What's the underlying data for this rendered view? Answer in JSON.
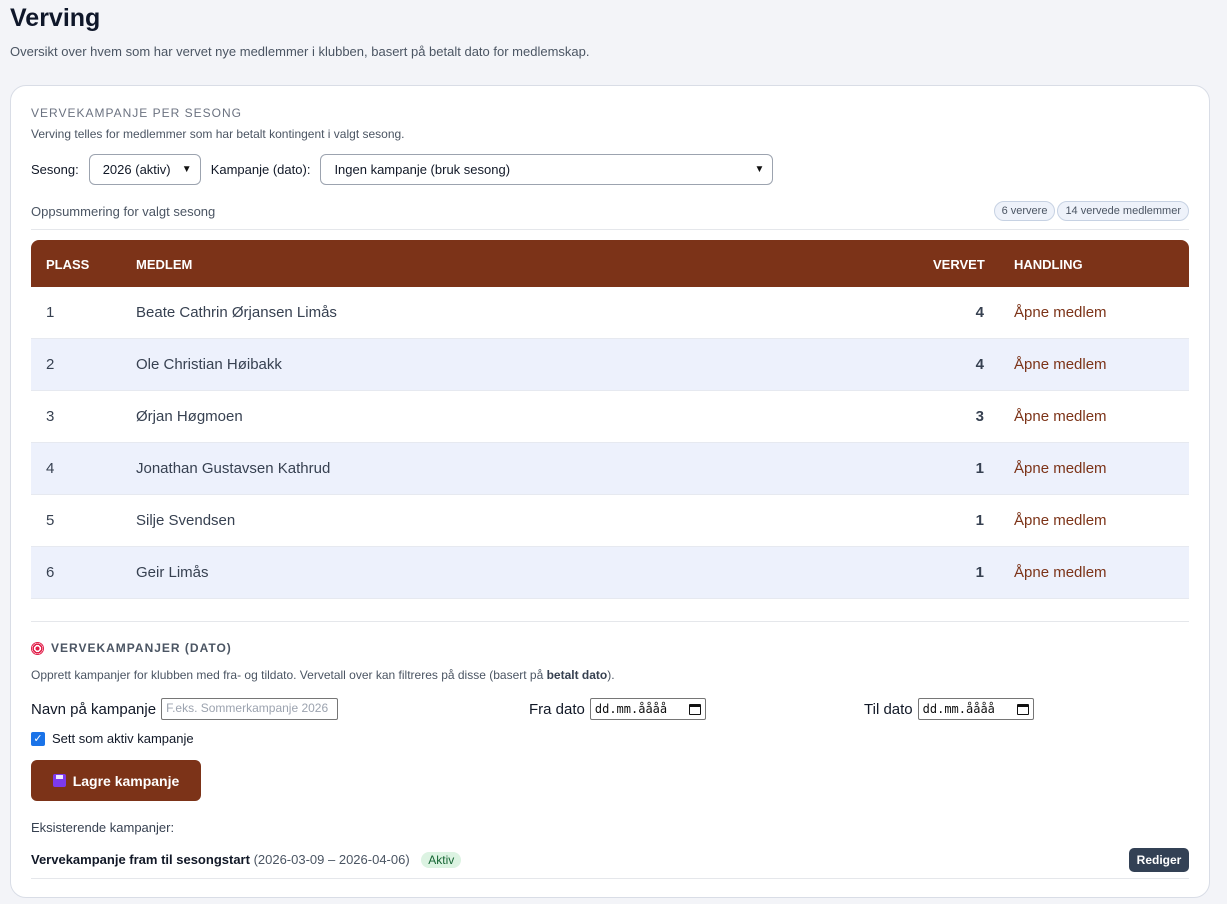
{
  "page": {
    "title": "Verving",
    "subtitle": "Oversikt over hvem som har vervet nye medlemmer i klubben, basert på betalt dato for medlemskap."
  },
  "season_section": {
    "heading": "VERVEKAMPANJE PER SESONG",
    "description": "Verving telles for medlemmer som har betalt kontingent i valgt sesong.",
    "season_label": "Sesong:",
    "season_value": "2026 (aktiv)",
    "campaign_label": "Kampanje (dato):",
    "campaign_value": "Ingen kampanje (bruk sesong)",
    "summary_label": "Oppsummering for valgt sesong",
    "pill_recruiters": "6 ververe",
    "pill_recruited": "14 vervede medlemmer"
  },
  "table": {
    "headers": {
      "place": "PLASS",
      "member": "MEDLEM",
      "recruited": "VERVET",
      "action": "HANDLING"
    },
    "rows": [
      {
        "place": "1",
        "member": "Beate Cathrin Ørjansen Limås",
        "recruited": "4",
        "action": "Åpne medlem"
      },
      {
        "place": "2",
        "member": "Ole Christian Høibakk",
        "recruited": "4",
        "action": "Åpne medlem"
      },
      {
        "place": "3",
        "member": "Ørjan Høgmoen",
        "recruited": "3",
        "action": "Åpne medlem"
      },
      {
        "place": "4",
        "member": "Jonathan Gustavsen Kathrud",
        "recruited": "1",
        "action": "Åpne medlem"
      },
      {
        "place": "5",
        "member": "Silje Svendsen",
        "recruited": "1",
        "action": "Åpne medlem"
      },
      {
        "place": "6",
        "member": "Geir Limås",
        "recruited": "1",
        "action": "Åpne medlem"
      }
    ]
  },
  "campaigns": {
    "heading": "VERVEKAMPANJER (DATO)",
    "icon": "target-icon",
    "description_start": "Opprett kampanjer for klubben med fra- og tildato. Vervetall over kan filtreres på disse (basert på ",
    "description_bold": "betalt dato",
    "description_end": ").",
    "name_label": "Navn på kampanje",
    "name_placeholder": "F.eks. Sommerkampanje 2026",
    "from_label": "Fra dato",
    "from_value": "dd.mm.åååå",
    "to_label": "Til dato",
    "to_value": "dd.mm.åååå",
    "active_checkbox_label": "Sett som aktiv kampanje",
    "active_checked": true,
    "save_label": "Lagre kampanje",
    "existing_label": "Eksisterende kampanjer:",
    "existing": [
      {
        "name": "Vervekampanje fram til sesongstart",
        "dates": "(2026-03-09 – 2026-04-06)",
        "status": "Aktiv",
        "edit_label": "Rediger"
      }
    ]
  },
  "colors": {
    "accent": "#7c3318",
    "row_alt": "#edf1fc",
    "badge_bg": "#dcf3e2",
    "edit_btn": "#334155"
  }
}
